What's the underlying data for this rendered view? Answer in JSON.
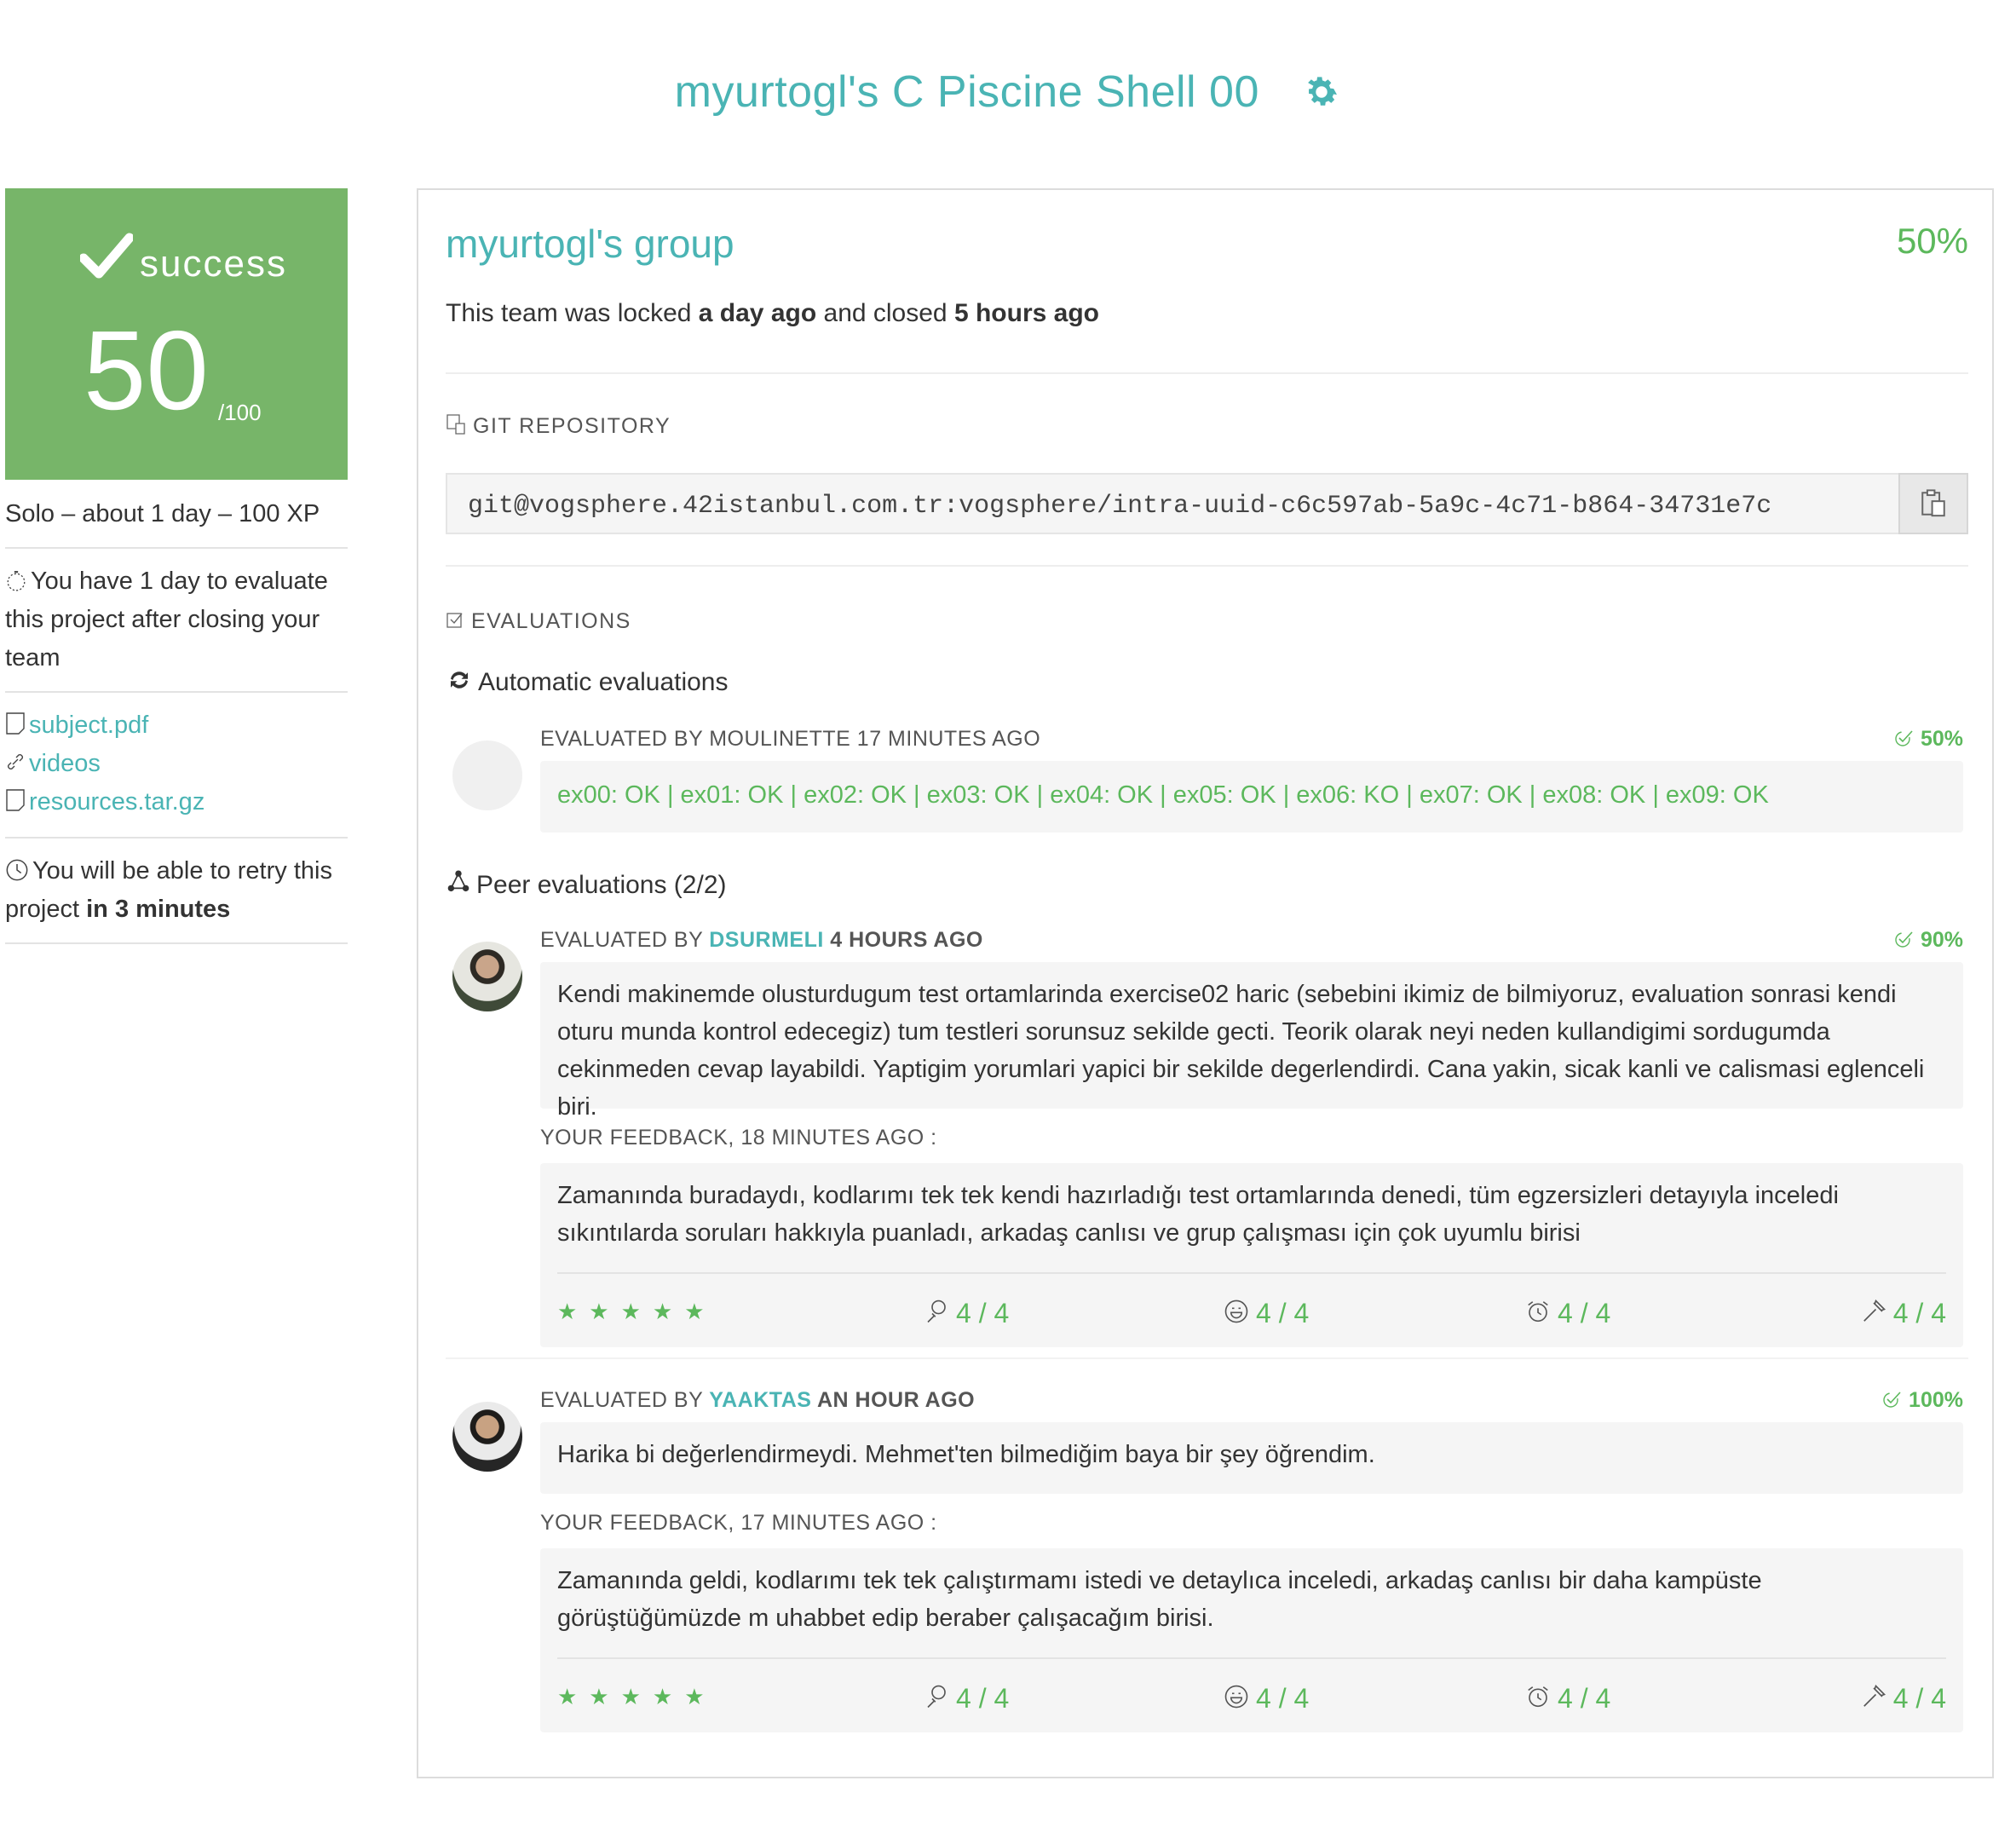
{
  "header": {
    "title": "myurtogl's C Piscine Shell 00"
  },
  "summary": {
    "status": "success",
    "score": "50",
    "max": "/100",
    "meta": "Solo – about 1 day – 100 XP",
    "evaluate_note_prefix": "You have 1 day to evaluate this project after closing your team",
    "files": [
      "subject.pdf",
      "videos",
      "resources.tar.gz"
    ],
    "retry_prefix": "You will be able to retry this project ",
    "retry_bold": "in 3 minutes"
  },
  "group": {
    "name": "myurtogl's group",
    "percent": "50%",
    "lock_prefix": "This team was locked ",
    "lock_when": "a day ago",
    "lock_mid": " and closed ",
    "closed_when": "5 hours ago"
  },
  "repo": {
    "heading": "GIT REPOSITORY",
    "url": "git@vogsphere.42istanbul.com.tr:vogsphere/intra-uuid-c6c597ab-5a9c-4c71-b864-34731e7c"
  },
  "evaluations": {
    "heading": "EVALUATIONS",
    "automatic_title": "Automatic evaluations",
    "auto": {
      "by": "EVALUATED BY MOULINETTE 17 MINUTES AGO",
      "percent": "50%",
      "results": "ex00: OK | ex01: OK | ex02: OK | ex03: OK | ex04: OK | ex05: OK | ex06: KO | ex07: OK | ex08: OK | ex09: OK"
    },
    "peer_title": "Peer evaluations (2/2)",
    "peers": [
      {
        "by_prefix": "EVALUATED BY ",
        "login": "DSURMELI",
        "when": " 4 HOURS AGO",
        "percent": "90%",
        "comment": "Kendi makinemde olusturdugum test ortamlarinda exercise02 haric (sebebini ikimiz de bilmiyoruz, evaluation sonrasi kendi oturu munda kontrol edecegiz) tum testleri sorunsuz sekilde gecti. Teorik olarak neyi neden kullandigimi sordugumda cekinmeden cevap layabildi. Yaptigim yorumlari yapici bir sekilde degerlendirdi. Cana yakin, sicak kanli ve calismasi eglenceli biri.",
        "feedback_label": "YOUR FEEDBACK, 18 MINUTES AGO :",
        "feedback": "Zamanında buradaydı, kodlarımı tek tek kendi hazırladığı test ortamlarında denedi, tüm egzersizleri detayıyla inceledi sıkıntılarda soruları hakkıyla puanladı, arkadaş canlısı ve grup çalışması için çok uyumlu birisi",
        "stars": "★★★★★",
        "ratings": [
          "4 / 4",
          "4 / 4",
          "4 / 4",
          "4 / 4"
        ]
      },
      {
        "by_prefix": "EVALUATED BY ",
        "login": "YAAKTAS",
        "when": " AN HOUR AGO",
        "percent": "100%",
        "comment": "Harika bi değerlendirmeydi. Mehmet'ten bilmediğim baya bir şey öğrendim.",
        "feedback_label": "YOUR FEEDBACK, 17 MINUTES AGO :",
        "feedback": "Zamanında geldi, kodlarımı tek tek çalıştırmamı istedi ve detaylıca inceledi, arkadaş canlısı bir daha kampüste görüştüğümüzde m uhabbet edip beraber çalışacağım birisi.",
        "stars": "★★★★★",
        "ratings": [
          "4 / 4",
          "4 / 4",
          "4 / 4",
          "4 / 4"
        ]
      }
    ]
  },
  "colors": {
    "accent": "#4ab4b4",
    "success": "#77b569",
    "green_text": "#5cb85c"
  }
}
